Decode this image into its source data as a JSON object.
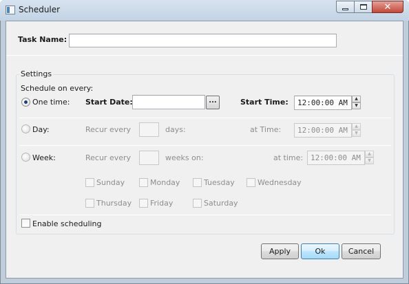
{
  "window": {
    "title": "Scheduler",
    "controls": {
      "minimize": "minimize",
      "maximize": "maximize",
      "close": "close"
    }
  },
  "task": {
    "label": "Task Name:",
    "value": ""
  },
  "settings": {
    "group_label": "Settings",
    "schedule_on_every": "Schedule on every:",
    "one_time": {
      "label": "One time:",
      "selected": true,
      "start_date_label": "Start Date:",
      "start_date_value": "",
      "browse_label": "...",
      "start_time_label": "Start Time:",
      "start_time_value": "12:00:00 AM"
    },
    "day": {
      "label": "Day:",
      "selected": false,
      "recur_label": "Recur every",
      "recur_value": "",
      "unit_label": "days:",
      "at_time_label": "at Time:",
      "time_value": "12:00:00 AM"
    },
    "week": {
      "label": "Week:",
      "selected": false,
      "recur_label": "Recur every",
      "recur_value": "",
      "unit_label": "weeks on:",
      "at_time_label": "at time:",
      "time_value": "12:00:00 AM",
      "days": [
        {
          "label": "Sunday",
          "checked": false
        },
        {
          "label": "Monday",
          "checked": false
        },
        {
          "label": "Tuesday",
          "checked": false
        },
        {
          "label": "Wednesday",
          "checked": false
        },
        {
          "label": "Thursday",
          "checked": false
        },
        {
          "label": "Friday",
          "checked": false
        },
        {
          "label": "Saturday",
          "checked": false
        }
      ]
    },
    "enable_scheduling": {
      "label": "Enable scheduling",
      "checked": false
    }
  },
  "buttons": {
    "apply": "Apply",
    "ok": "Ok",
    "cancel": "Cancel"
  },
  "spin": {
    "up": "▲",
    "down": "▼"
  },
  "colors": {
    "titlebar": "#c9d9e9",
    "dialog_bg": "#f0f0f0",
    "close_button": "#c7493b",
    "default_button": "#bee6fd",
    "disabled_text": "#8d8d8d"
  }
}
